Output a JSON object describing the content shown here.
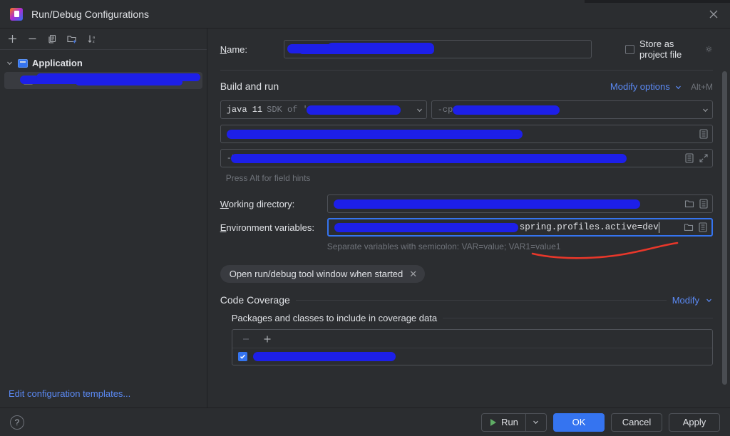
{
  "window": {
    "title": "Run/Debug Configurations",
    "app_icon": "intellij-idea-icon",
    "close_icon": "close-icon"
  },
  "sidebar": {
    "toolbar": [
      {
        "name": "add-configuration-button",
        "icon": "plus-icon"
      },
      {
        "name": "remove-configuration-button",
        "icon": "minus-icon"
      },
      {
        "name": "copy-configuration-button",
        "icon": "copy-icon"
      },
      {
        "name": "new-folder-button",
        "icon": "new-folder-icon"
      },
      {
        "name": "sort-configurations-button",
        "icon": "sort-alpha-icon"
      }
    ],
    "tree": {
      "group_label": "Application",
      "group_icon": "application-icon",
      "child_label": "",
      "child_redacted": true
    },
    "edit_templates_link": "Edit configuration templates..."
  },
  "main": {
    "name_label": "Name:",
    "name_value": "",
    "name_redacted": true,
    "store_as_project_file": {
      "label": "Store as project file",
      "checked": false,
      "gear_icon": "gear-icon"
    },
    "build_and_run": {
      "title": "Build and run",
      "modify_options_link": "Modify options",
      "modify_options_shortcut": "Alt+M",
      "sdk_prefix": "java 11",
      "sdk_suffix": "SDK of '",
      "sdk_redacted": true,
      "classpath_prefix": "-cp",
      "classpath_redacted": true,
      "main_class_redacted": true,
      "vm_args_redacted": true,
      "field_hint": "Press Alt for field hints"
    },
    "working_directory": {
      "label": "Working directory:",
      "value": "",
      "redacted": true,
      "browse_icon": "folder-icon",
      "macro_icon": "list-icon"
    },
    "environment_variables": {
      "label": "Environment variables:",
      "visible_value": "spring.profiles.active=dev",
      "redacted_prefix": true,
      "focused": true,
      "browse_icon": "folder-icon",
      "macro_icon": "list-icon",
      "hint": "Separate variables with semicolon: VAR=value; VAR1=value1",
      "annotation": "red-underline-stroke"
    },
    "chip": {
      "label": "Open run/debug tool window when started",
      "close_icon": "close-small-icon"
    },
    "code_coverage": {
      "title": "Code Coverage",
      "modify_link": "Modify",
      "packages_title": "Packages and classes to include in coverage data",
      "list_toolbar": [
        {
          "name": "remove-package-button",
          "icon": "minus-icon",
          "disabled": true
        },
        {
          "name": "add-package-button",
          "icon": "plus-icon",
          "disabled": false
        }
      ],
      "rows": [
        {
          "checked": true,
          "label": "",
          "redacted": true
        }
      ]
    },
    "scrollbar": "vertical-scrollbar"
  },
  "footer": {
    "help_label": "?",
    "run_label": "Run",
    "run_icon": "play-icon",
    "run_dropdown_icon": "chevron-down-icon",
    "ok_label": "OK",
    "cancel_label": "Cancel",
    "apply_label": "Apply"
  },
  "colors": {
    "accent_blue": "#3574f0",
    "link_blue": "#5b8af5",
    "bg": "#2b2d30",
    "redaction": "#1d1fe8",
    "annotation_red": "#e8372a",
    "play_green": "#5fad65"
  }
}
